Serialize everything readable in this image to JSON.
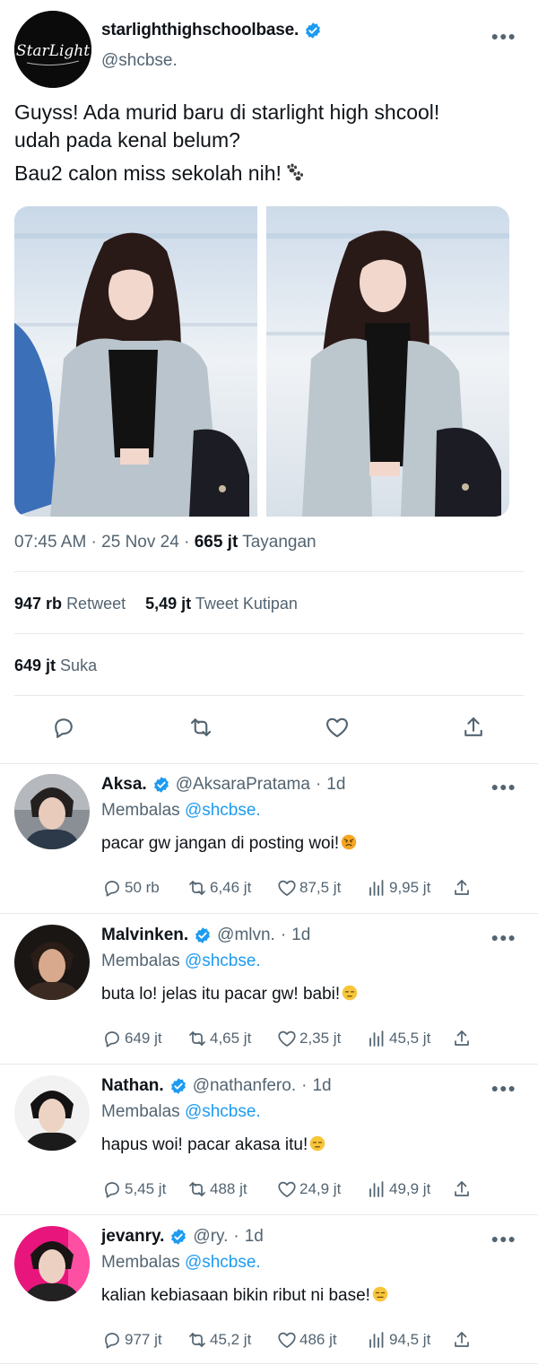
{
  "colors": {
    "accent": "#1d9bf0",
    "text": "#0f1419",
    "muted": "#536471",
    "divider": "#e6e9eb"
  },
  "tweet": {
    "avatar_text": "StarLight",
    "name": "starlighthighschoolbase.",
    "handle": "@shcbse.",
    "text_line1": "Guyss! Ada murid baru di starlight high shcool!",
    "text_line2": "udah pada kenal belum?",
    "text_line3": "Bau2 calon miss sekolah nih!",
    "time": "07:45 AM",
    "date": "25 Nov 24",
    "views_count": "665 jt",
    "views_label": "Tayangan",
    "retweets_count": "947 rb",
    "retweets_label": "Retweet",
    "quotes_count": "5,49 jt",
    "quotes_label": "Tweet Kutipan",
    "likes_count": "649 jt",
    "likes_label": "Suka"
  },
  "replies": [
    {
      "name": "Aksa.",
      "handle": "@AksaraPratama",
      "time": "1d",
      "replying_prefix": "Membalas",
      "replying_to": "@shcbse.",
      "text": "pacar gw jangan di posting woi!",
      "emoji": "angry-face",
      "replies": "50 rb",
      "retweets": "6,46 jt",
      "likes": "87,5 jt",
      "views": "9,95 jt"
    },
    {
      "name": "Malvinken.",
      "handle": "@mlvn.",
      "time": "1d",
      "replying_prefix": "Membalas",
      "replying_to": "@shcbse.",
      "text": "buta lo! jelas itu pacar gw! babi!",
      "emoji": "unamused-face",
      "replies": "649 jt",
      "retweets": "4,65 jt",
      "likes": "2,35 jt",
      "views": "45,5 jt"
    },
    {
      "name": "Nathan.",
      "handle": "@nathanfero.",
      "time": "1d",
      "replying_prefix": "Membalas",
      "replying_to": "@shcbse.",
      "text": "hapus woi! pacar akasa itu!",
      "emoji": "unamused-face",
      "replies": "5,45 jt",
      "retweets": "488 jt",
      "likes": "24,9 jt",
      "views": "49,9 jt"
    },
    {
      "name": "jevanry.",
      "handle": "@ry.",
      "time": "1d",
      "replying_prefix": "Membalas",
      "replying_to": "@shcbse.",
      "text": "kalian kebiasaan bikin ribut ni base!",
      "emoji": "expressionless-face",
      "replies": "977 jt",
      "retweets": "45,2 jt",
      "likes": "486 jt",
      "views": "94,5 jt"
    }
  ]
}
